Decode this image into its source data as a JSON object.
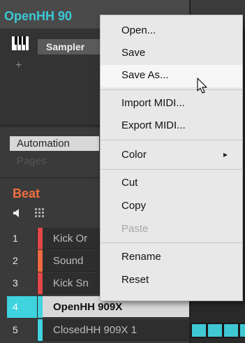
{
  "header": {
    "title": "OpenHH 90"
  },
  "plugin": {
    "name": "Sampler",
    "add_symbol": "+"
  },
  "automation": {
    "button_label": "Automation",
    "pages_label": "Pages"
  },
  "group": {
    "name": "Beat"
  },
  "sounds": [
    {
      "num": "1",
      "name": "Kick Or",
      "color": "#e24848"
    },
    {
      "num": "2",
      "name": "Sound",
      "color": "#ee6a42"
    },
    {
      "num": "3",
      "name": "Kick Sn",
      "color": "#e24848"
    },
    {
      "num": "4",
      "name": "OpenHH 909X",
      "color": "#3fd3de"
    },
    {
      "num": "5",
      "name": "ClosedHH 909X 1",
      "color": "#3fd3de"
    }
  ],
  "context_menu": {
    "items": [
      {
        "label": "Open...",
        "state": "normal"
      },
      {
        "label": "Save",
        "state": "normal"
      },
      {
        "label": "Save As...",
        "state": "hover"
      },
      {
        "label": "Import MIDI...",
        "state": "normal"
      },
      {
        "label": "Export MIDI...",
        "state": "normal"
      },
      {
        "label": "Color",
        "state": "normal",
        "submenu": true
      },
      {
        "label": "Cut",
        "state": "normal"
      },
      {
        "label": "Copy",
        "state": "normal"
      },
      {
        "label": "Paste",
        "state": "disabled"
      },
      {
        "label": "Rename",
        "state": "normal"
      },
      {
        "label": "Reset",
        "state": "normal"
      }
    ],
    "submenu_arrow": "▸"
  },
  "colors": {
    "accent": "#3fd3de",
    "group": "#f07040",
    "menu_bg": "#e8e8e8"
  }
}
